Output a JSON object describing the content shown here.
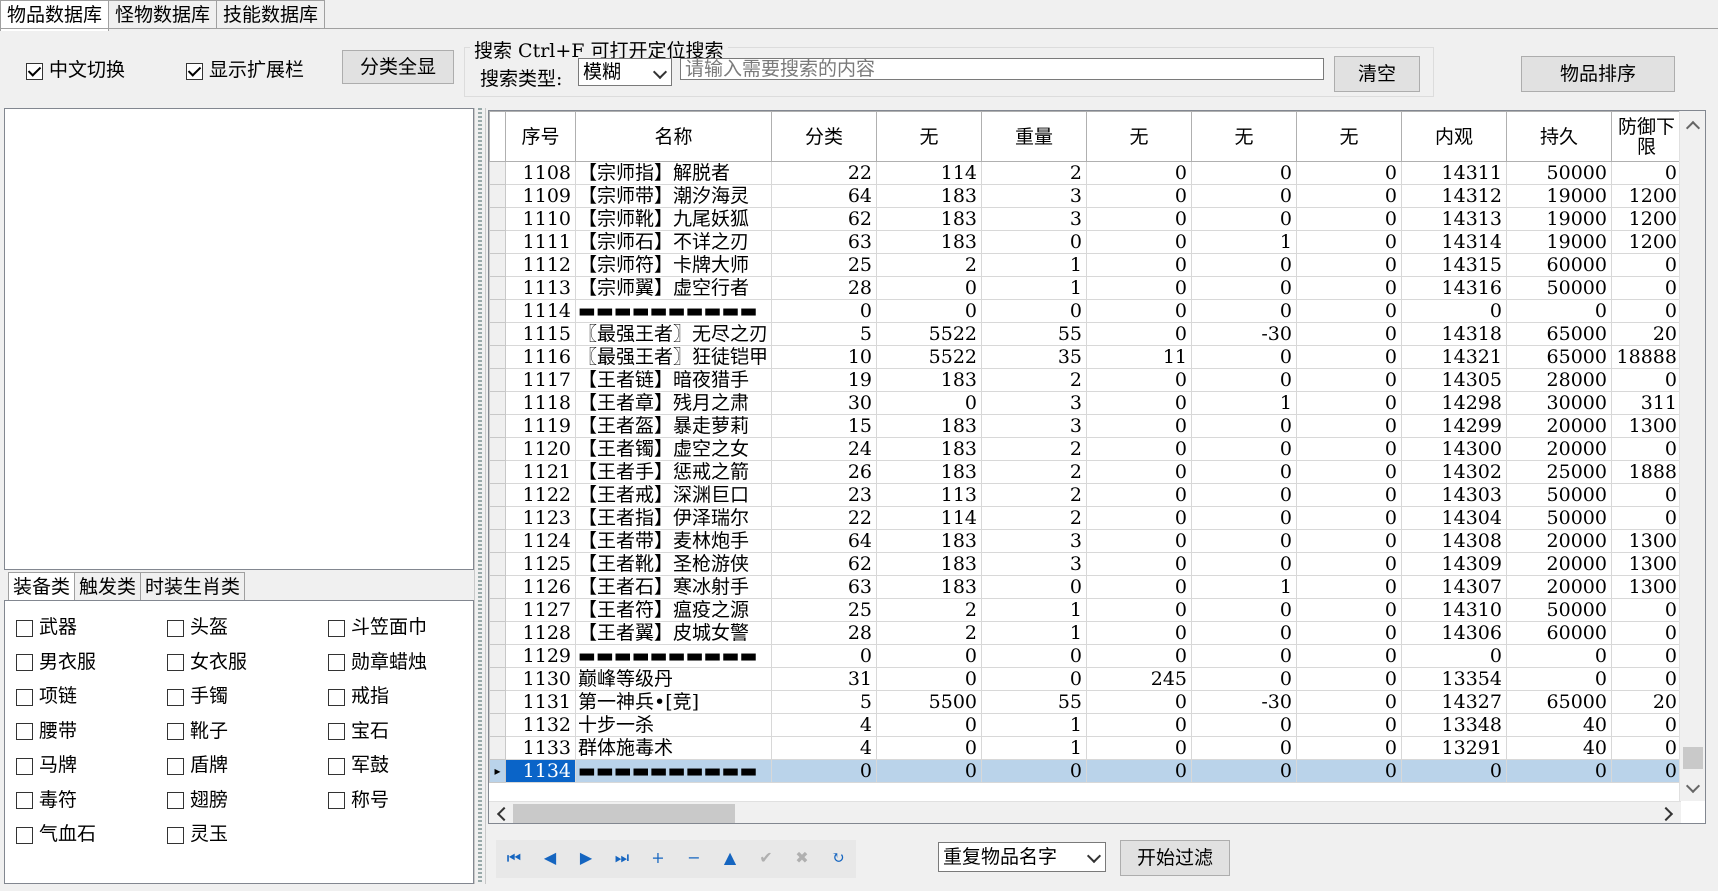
{
  "tabs": [
    "物品数据库",
    "怪物数据库",
    "技能数据库"
  ],
  "toolbar": {
    "chinese_toggle": "中文切换",
    "show_ext": "显示扩展栏",
    "show_all_btn": "分类全显",
    "search_title": "搜索  Ctrl+F 可打开定位搜索",
    "search_type_label": "搜索类型:",
    "search_type_value": "模糊",
    "search_placeholder": "请输入需要搜索的内容",
    "clear_btn": "清空",
    "sort_btn": "物品排序"
  },
  "category_tabs": [
    "装备类",
    "触发类",
    "时装生肖类"
  ],
  "categories": [
    "武器",
    "头盔",
    "斗笠面巾",
    "男衣服",
    "女衣服",
    "勋章蜡烛",
    "项链",
    "手镯",
    "戒指",
    "腰带",
    "靴子",
    "宝石",
    "马牌",
    "盾牌",
    "军鼓",
    "毒符",
    "翅膀",
    "称号",
    "气血石",
    "灵玉"
  ],
  "grid": {
    "columns": [
      "序号",
      "名称",
      "分类",
      "无",
      "重量",
      "无",
      "无",
      "无",
      "内观",
      "持久",
      "防御下限"
    ],
    "rows": [
      [
        "1108",
        "【宗师指】解脱者",
        "22",
        "114",
        "2",
        "0",
        "0",
        "0",
        "14311",
        "50000",
        "0"
      ],
      [
        "1109",
        "【宗师带】潮汐海灵",
        "64",
        "183",
        "3",
        "0",
        "0",
        "0",
        "14312",
        "19000",
        "1200"
      ],
      [
        "1110",
        "【宗师靴】九尾妖狐",
        "62",
        "183",
        "3",
        "0",
        "0",
        "0",
        "14313",
        "19000",
        "1200"
      ],
      [
        "1111",
        "【宗师石】不详之刃",
        "63",
        "183",
        "0",
        "0",
        "1",
        "0",
        "14314",
        "19000",
        "1200"
      ],
      [
        "1112",
        "【宗师符】卡牌大师",
        "25",
        "2",
        "1",
        "0",
        "0",
        "0",
        "14315",
        "60000",
        "0"
      ],
      [
        "1113",
        "【宗师翼】虚空行者",
        "28",
        "0",
        "1",
        "0",
        "0",
        "0",
        "14316",
        "50000",
        "0"
      ],
      [
        "1114",
        "▬▬▬▬▬▬▬▬▬▬",
        "0",
        "0",
        "0",
        "0",
        "0",
        "0",
        "0",
        "0",
        "0"
      ],
      [
        "1115",
        "〖最强王者〗无尽之刃",
        "5",
        "5522",
        "55",
        "0",
        "-30",
        "0",
        "14318",
        "65000",
        "20"
      ],
      [
        "1116",
        "〖最强王者〗狂徒铠甲",
        "10",
        "5522",
        "35",
        "11",
        "0",
        "0",
        "14321",
        "65000",
        "18888"
      ],
      [
        "1117",
        "【王者链】暗夜猎手",
        "19",
        "183",
        "2",
        "0",
        "0",
        "0",
        "14305",
        "28000",
        "0"
      ],
      [
        "1118",
        "【王者章】残月之肃",
        "30",
        "0",
        "3",
        "0",
        "1",
        "0",
        "14298",
        "30000",
        "311"
      ],
      [
        "1119",
        "【王者盔】暴走萝莉",
        "15",
        "183",
        "3",
        "0",
        "0",
        "0",
        "14299",
        "20000",
        "1300"
      ],
      [
        "1120",
        "【王者镯】虚空之女",
        "24",
        "183",
        "2",
        "0",
        "0",
        "0",
        "14300",
        "20000",
        "0"
      ],
      [
        "1121",
        "【王者手】惩戒之箭",
        "26",
        "183",
        "2",
        "0",
        "0",
        "0",
        "14302",
        "25000",
        "1888"
      ],
      [
        "1122",
        "【王者戒】深渊巨口",
        "23",
        "113",
        "2",
        "0",
        "0",
        "0",
        "14303",
        "50000",
        "0"
      ],
      [
        "1123",
        "【王者指】伊泽瑞尔",
        "22",
        "114",
        "2",
        "0",
        "0",
        "0",
        "14304",
        "50000",
        "0"
      ],
      [
        "1124",
        "【王者带】麦林炮手",
        "64",
        "183",
        "3",
        "0",
        "0",
        "0",
        "14308",
        "20000",
        "1300"
      ],
      [
        "1125",
        "【王者靴】圣枪游侠",
        "62",
        "183",
        "3",
        "0",
        "0",
        "0",
        "14309",
        "20000",
        "1300"
      ],
      [
        "1126",
        "【王者石】寒冰射手",
        "63",
        "183",
        "0",
        "0",
        "1",
        "0",
        "14307",
        "20000",
        "1300"
      ],
      [
        "1127",
        "【王者符】瘟疫之源",
        "25",
        "2",
        "1",
        "0",
        "0",
        "0",
        "14310",
        "50000",
        "0"
      ],
      [
        "1128",
        "【王者翼】皮城女警",
        "28",
        "2",
        "1",
        "0",
        "0",
        "0",
        "14306",
        "60000",
        "0"
      ],
      [
        "1129",
        "▬▬▬▬▬▬▬▬▬▬",
        "0",
        "0",
        "0",
        "0",
        "0",
        "0",
        "0",
        "0",
        "0"
      ],
      [
        "1130",
        "巅峰等级丹",
        "31",
        "0",
        "0",
        "245",
        "0",
        "0",
        "13354",
        "0",
        "0"
      ],
      [
        "1131",
        "第一神兵•[竞]",
        "5",
        "5500",
        "55",
        "0",
        "-30",
        "0",
        "14327",
        "65000",
        "20"
      ],
      [
        "1132",
        "十步一杀",
        "4",
        "0",
        "1",
        "0",
        "0",
        "0",
        "13348",
        "40",
        "0"
      ],
      [
        "1133",
        "群体施毒术",
        "4",
        "0",
        "1",
        "0",
        "0",
        "0",
        "13291",
        "40",
        "0"
      ],
      [
        "1134",
        "▬▬▬▬▬▬▬▬▬▬",
        "0",
        "0",
        "0",
        "0",
        "0",
        "0",
        "0",
        "0",
        "0"
      ]
    ],
    "selected_row": "1134"
  },
  "bottom": {
    "filter_select": "重复物品名字",
    "filter_btn": "开始过滤"
  }
}
